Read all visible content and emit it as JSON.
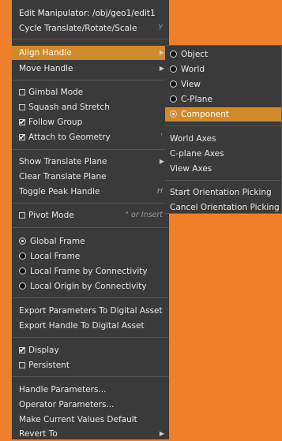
{
  "main_menu": {
    "title": "Edit Manipulator: /obj/geo1/edit1",
    "cycle": {
      "label": "Cycle Translate/Rotate/Scale",
      "hotkey": "Y"
    },
    "align_handle": "Align Handle",
    "move_handle": "Move Handle",
    "gimbal_mode": {
      "label": "Gimbal Mode",
      "checked": false
    },
    "squash_stretch": {
      "label": "Squash and Stretch",
      "checked": false
    },
    "follow_group": {
      "label": "Follow Group",
      "checked": true
    },
    "attach_geometry": {
      "label": "Attach to Geometry",
      "checked": true,
      "hotkey": "'"
    },
    "show_translate_plane": "Show Translate Plane",
    "clear_translate_plane": "Clear Translate Plane",
    "toggle_peak": {
      "label": "Toggle Peak Handle",
      "hotkey": "H"
    },
    "pivot_mode": {
      "label": "Pivot Mode",
      "checked": false,
      "hotkey": "\" or Insert"
    },
    "frames": [
      {
        "label": "Global Frame",
        "selected": true
      },
      {
        "label": "Local Frame",
        "selected": false
      },
      {
        "label": "Local Frame by Connectivity",
        "selected": false
      },
      {
        "label": "Local Origin by Connectivity",
        "selected": false
      }
    ],
    "export_params": "Export Parameters To Digital Asset",
    "export_handle": "Export Handle To Digital Asset",
    "display": {
      "label": "Display",
      "checked": true
    },
    "persistent": {
      "label": "Persistent",
      "checked": false
    },
    "handle_params": "Handle Parameters...",
    "operator_params": "Operator Parameters...",
    "make_default": "Make Current Values Default",
    "revert_to": "Revert To"
  },
  "align_submenu": {
    "options": [
      {
        "label": "Object",
        "selected": false
      },
      {
        "label": "World",
        "selected": false
      },
      {
        "label": "View",
        "selected": false
      },
      {
        "label": "C-Plane",
        "selected": false
      },
      {
        "label": "Component",
        "selected": true
      }
    ],
    "world_axes": "World Axes",
    "cplane_axes": "C-plane Axes",
    "view_axes": "View Axes",
    "start_picking": "Start Orientation Picking",
    "cancel_picking": "Cancel Orientation Picking"
  },
  "colors": {
    "background": "#ef7f2b",
    "menu": "#3a3a3a",
    "highlight": "#d08a2a"
  }
}
